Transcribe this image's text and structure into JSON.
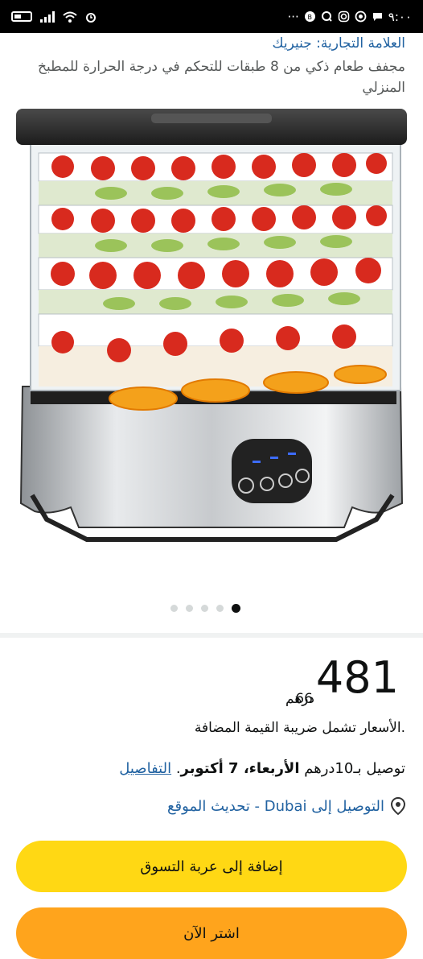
{
  "status_bar": {
    "time": "٩:٠٠",
    "right_icons": [
      "battery-icon",
      "signal-icon",
      "wifi-icon",
      "alarm-icon"
    ],
    "left_icons": [
      "chat-icon",
      "whatsapp-icon",
      "instagram-icon",
      "q-app-icon",
      "whatsapp-business-icon",
      "more-icon"
    ]
  },
  "product": {
    "brand": "العلامة التجارية: جنيريك",
    "title": "مجفف طعام ذكي من 8 طبقات للتحكم في درجة الحرارة للمطبخ المنزلي",
    "image_count": 5,
    "active_image": 1
  },
  "price": {
    "whole": "481",
    "fraction": "66",
    "currency": "درهم",
    "vat_note": ".الأسعار تشمل ضريبة القيمة المضافة"
  },
  "delivery": {
    "prefix": "توصيل بـ10درهم",
    "date": "الأربعاء، 7 أكتوبر",
    "details_link": "التفاصيل"
  },
  "location": {
    "text": "التوصيل إلى Dubai - تحديث الموقع"
  },
  "buttons": {
    "add_to_cart": "إضافة إلى عربة التسوق",
    "buy_now": "اشتر الآن"
  },
  "colors": {
    "link": "#2162a1",
    "add_to_cart": "#ffd814",
    "buy_now": "#ffa41c"
  }
}
